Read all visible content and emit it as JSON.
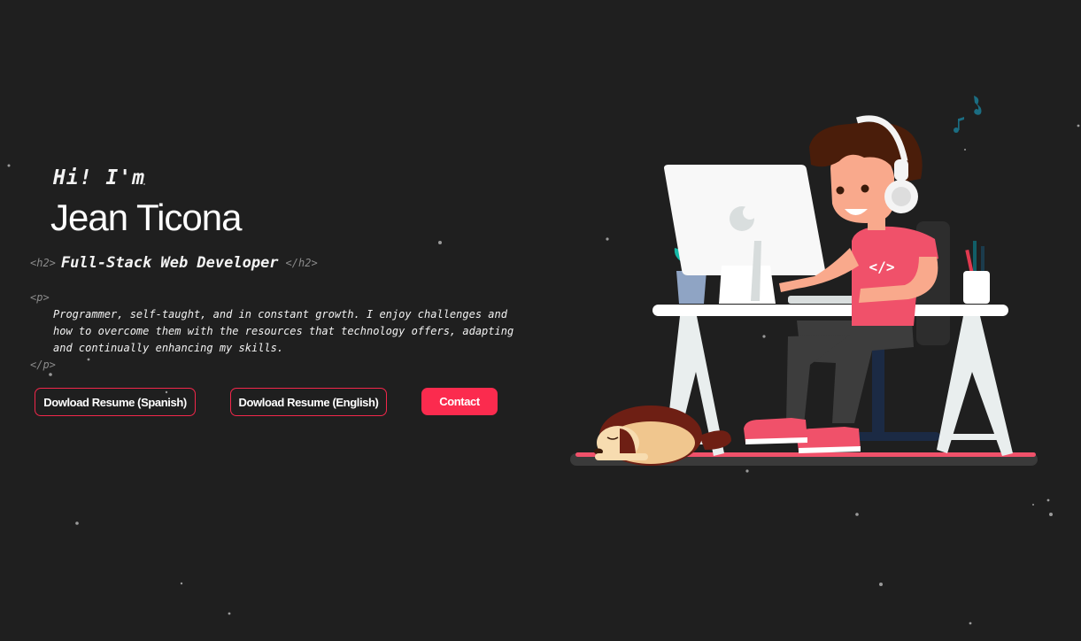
{
  "hero": {
    "greeting": "Hi! I'm",
    "name": "Jean Ticona",
    "h2_open": "<h2>",
    "role": "Full-Stack Web Developer",
    "h2_close": "</h2>",
    "p_open": "<p>",
    "bio": "Programmer, self-taught, and in constant growth. I enjoy challenges and how to overcome them with the resources that technology offers, adapting and continually enhancing my skills.",
    "p_close": "</p>"
  },
  "buttons": {
    "resume_spanish": "Dowload Resume (Spanish)",
    "resume_english": "Dowload Resume (English)",
    "contact": "Contact"
  },
  "illustration": {
    "shirt_code": "</>",
    "icon": "developer-at-desk-illustration"
  },
  "colors": {
    "background": "#1f1f1f",
    "accent": "#fb2b4e",
    "tag_gray": "#8b8b8b",
    "shirt": "#f0516a",
    "hair": "#4a1d0a",
    "teal_notes": "#1b6d82"
  }
}
